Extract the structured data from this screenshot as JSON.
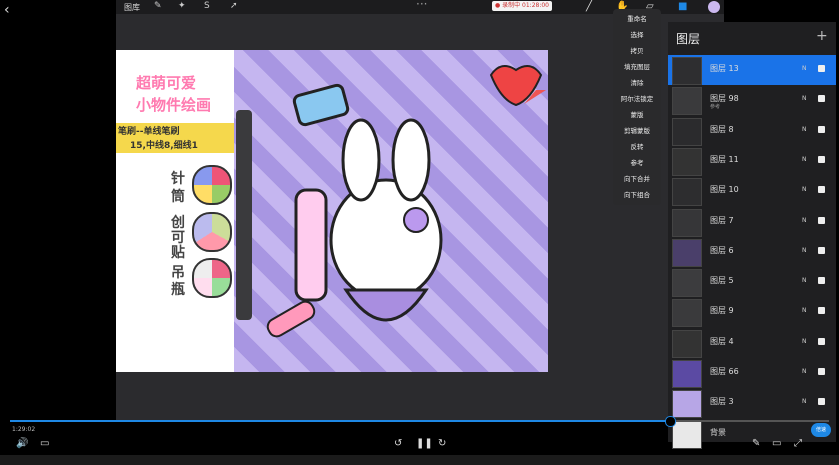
{
  "top": {
    "gallery": "图库",
    "recording": "● 录制中 01:28:00"
  },
  "menu": [
    "重命名",
    "选择",
    "拷贝",
    "填充图层",
    "清除",
    "阿尔法锁定",
    "蒙版",
    "剪辑蒙版",
    "反转",
    "参考",
    "向下合并",
    "向下组合"
  ],
  "layers_panel": {
    "title": "图层",
    "add": "+",
    "layers": [
      {
        "name": "图层 13",
        "sub": "",
        "mode": "N",
        "selected": true
      },
      {
        "name": "图层 98",
        "sub": "参考",
        "mode": "N"
      },
      {
        "name": "图层 8",
        "sub": "",
        "mode": "N"
      },
      {
        "name": "图层 11",
        "sub": "",
        "mode": "N"
      },
      {
        "name": "图层 10",
        "sub": "",
        "mode": "N"
      },
      {
        "name": "图层 7",
        "sub": "",
        "mode": "N"
      },
      {
        "name": "图层 6",
        "sub": "",
        "mode": "N"
      },
      {
        "name": "图层 5",
        "sub": "",
        "mode": "N"
      },
      {
        "name": "图层 9",
        "sub": "",
        "mode": "N"
      },
      {
        "name": "图层 4",
        "sub": "",
        "mode": "N"
      },
      {
        "name": "图层 66",
        "sub": "",
        "mode": "N"
      },
      {
        "name": "图层 3",
        "sub": "",
        "mode": "N"
      },
      {
        "name": "背景",
        "sub": "",
        "mode": ""
      }
    ]
  },
  "artwork": {
    "title1": "超萌可爱",
    "title2": "小物件绘画",
    "sub1": "笔刷--单线笔刷",
    "sub2": "15,中线8,细线1",
    "labels": [
      "针",
      "筒",
      "创",
      "可",
      "贴",
      "吊",
      "瓶"
    ]
  },
  "player": {
    "time": "1:29:02",
    "progress": 0.81,
    "speed": "倍速"
  },
  "colors": {
    "accent": "#1e88e5",
    "selected_layer": "#1a73e8"
  }
}
